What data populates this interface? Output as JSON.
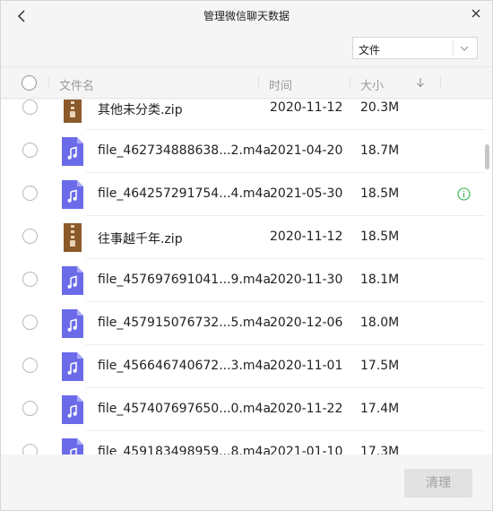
{
  "window": {
    "title": "管理微信聊天数据"
  },
  "filter": {
    "value": "文件"
  },
  "columns": {
    "name": "文件名",
    "time": "时间",
    "size": "大小"
  },
  "rows": [
    {
      "name": "其他未分类.zip",
      "time": "2020-11-12",
      "size": "20.3M",
      "type": "zip"
    },
    {
      "name": "file_462734888638...2.m4a",
      "time": "2021-04-20",
      "size": "18.7M",
      "type": "audio"
    },
    {
      "name": "file_464257291754...4.m4a",
      "time": "2021-05-30",
      "size": "18.5M",
      "type": "audio",
      "info": true
    },
    {
      "name": "往事越千年.zip",
      "time": "2020-11-12",
      "size": "18.5M",
      "type": "zip"
    },
    {
      "name": "file_457697691041...9.m4a",
      "time": "2020-11-30",
      "size": "18.1M",
      "type": "audio"
    },
    {
      "name": "file_457915076732...5.m4a",
      "time": "2020-12-06",
      "size": "18.0M",
      "type": "audio"
    },
    {
      "name": "file_456646740672...3.m4a",
      "time": "2020-11-01",
      "size": "17.5M",
      "type": "audio"
    },
    {
      "name": "file_457407697650...0.m4a",
      "time": "2020-11-22",
      "size": "17.4M",
      "type": "audio"
    },
    {
      "name": "file_459183498959...8.m4a",
      "time": "2021-01-10",
      "size": "17.3M",
      "type": "audio"
    }
  ],
  "footer": {
    "clean_label": "清理"
  },
  "colors": {
    "zip_icon": "#8b5a2b",
    "audio_icon": "#6b6bea",
    "info_icon": "#2bb24c",
    "button_disabled": "#e2e2e2"
  },
  "icons": {
    "back": "chevron-left-icon",
    "close": "close-icon",
    "dropdown": "chevron-down-icon",
    "sort": "arrow-down-icon",
    "zip": "zip-file-icon",
    "audio": "audio-file-icon",
    "info": "info-icon"
  }
}
